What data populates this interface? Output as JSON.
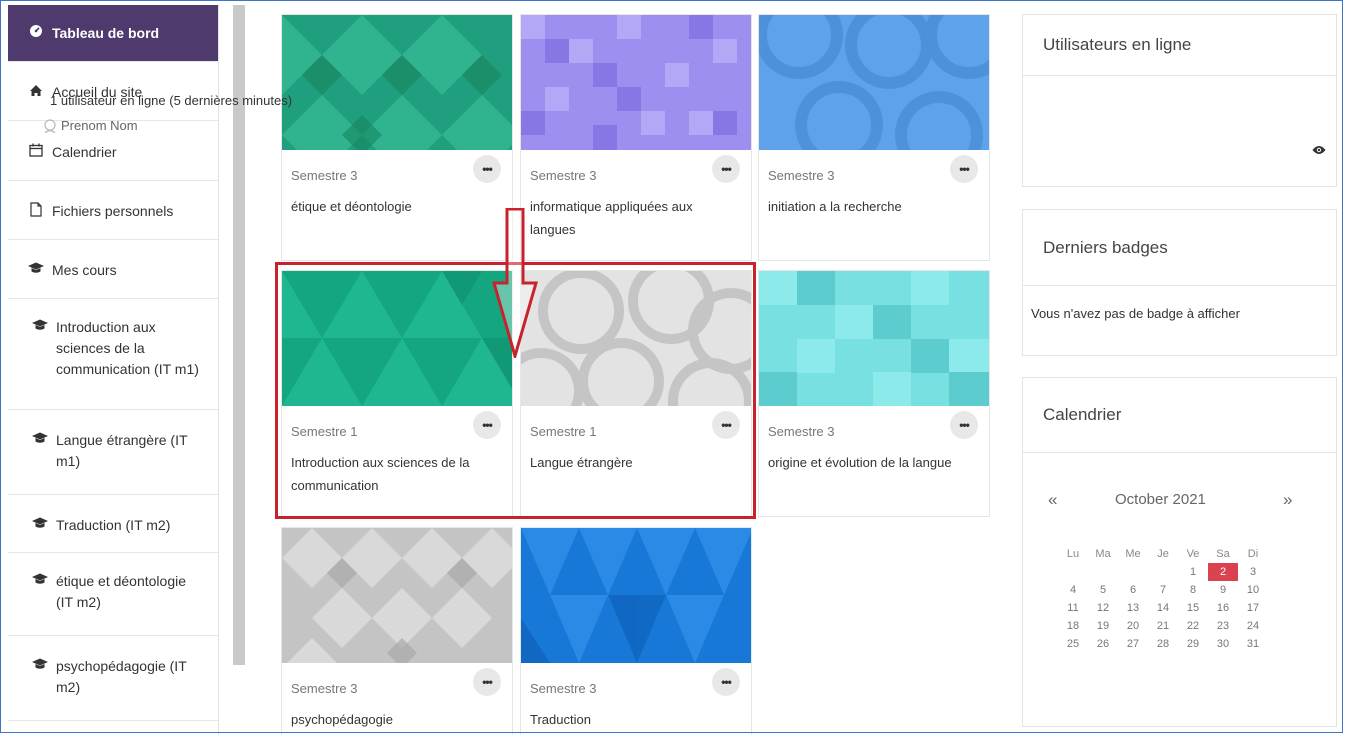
{
  "nav": {
    "items": [
      {
        "label": "Tableau de bord",
        "icon": "dashboard-icon"
      },
      {
        "label": "Accueil du site",
        "icon": "home-icon"
      },
      {
        "label": "Calendrier",
        "icon": "calendar-icon"
      },
      {
        "label": "Fichiers personnels",
        "icon": "file-icon"
      },
      {
        "label": "Mes cours",
        "icon": "graduation-cap-icon"
      },
      {
        "label": "Introduction aux sciences de la communication (IT m1)",
        "icon": "graduation-cap-icon"
      },
      {
        "label": "Langue étrangère (IT m1)",
        "icon": "graduation-cap-icon"
      },
      {
        "label": "Traduction (IT m2)",
        "icon": "graduation-cap-icon"
      },
      {
        "label": "étique et déontologie (IT m2)",
        "icon": "graduation-cap-icon"
      },
      {
        "label": "psychopédagogie (IT m2)",
        "icon": "graduation-cap-icon"
      }
    ]
  },
  "courses": [
    {
      "semester": "Semestre 3",
      "name": "étique et déontologie",
      "more": "•••"
    },
    {
      "semester": "Semestre 3",
      "name": "informatique appliquées aux langues",
      "more": "•••"
    },
    {
      "semester": "Semestre 3",
      "name": "initiation a la recherche",
      "more": "•••"
    },
    {
      "semester": "Semestre 1",
      "name": "Introduction aux sciences de la communication",
      "more": "•••"
    },
    {
      "semester": "Semestre 1",
      "name": "Langue étrangère",
      "more": "•••"
    },
    {
      "semester": "Semestre 3",
      "name": "origine et évolution de la langue",
      "more": "•••"
    },
    {
      "semester": "Semestre 3",
      "name": "psychopédagogie",
      "more": "•••"
    },
    {
      "semester": "Semestre 3",
      "name": "Traduction",
      "more": "•••"
    }
  ],
  "blocks": {
    "online": {
      "title": "Utilisateurs en ligne",
      "summary": "1 utilisateur en ligne (5 dernières minutes)",
      "user": "Prenom Nom"
    },
    "badges": {
      "title": "Derniers badges",
      "empty": "Vous n'avez pas de badge à afficher"
    },
    "calendar": {
      "title": "Calendrier",
      "prev": "«",
      "next": "»",
      "month": "October 2021",
      "weekdays": [
        "Lu",
        "Ma",
        "Me",
        "Je",
        "Ve",
        "Sa",
        "Di"
      ],
      "weeks": [
        [
          "",
          "",
          "",
          "",
          "1",
          "2",
          "3"
        ],
        [
          "4",
          "5",
          "6",
          "7",
          "8",
          "9",
          "10"
        ],
        [
          "11",
          "12",
          "13",
          "14",
          "15",
          "16",
          "17"
        ],
        [
          "18",
          "19",
          "20",
          "21",
          "22",
          "23",
          "24"
        ],
        [
          "25",
          "26",
          "27",
          "28",
          "29",
          "30",
          "31"
        ]
      ],
      "today": "2"
    }
  },
  "colors": {
    "active_nav": "#4e3a6d",
    "highlight": "#c8232c",
    "today": "#d9434f"
  }
}
